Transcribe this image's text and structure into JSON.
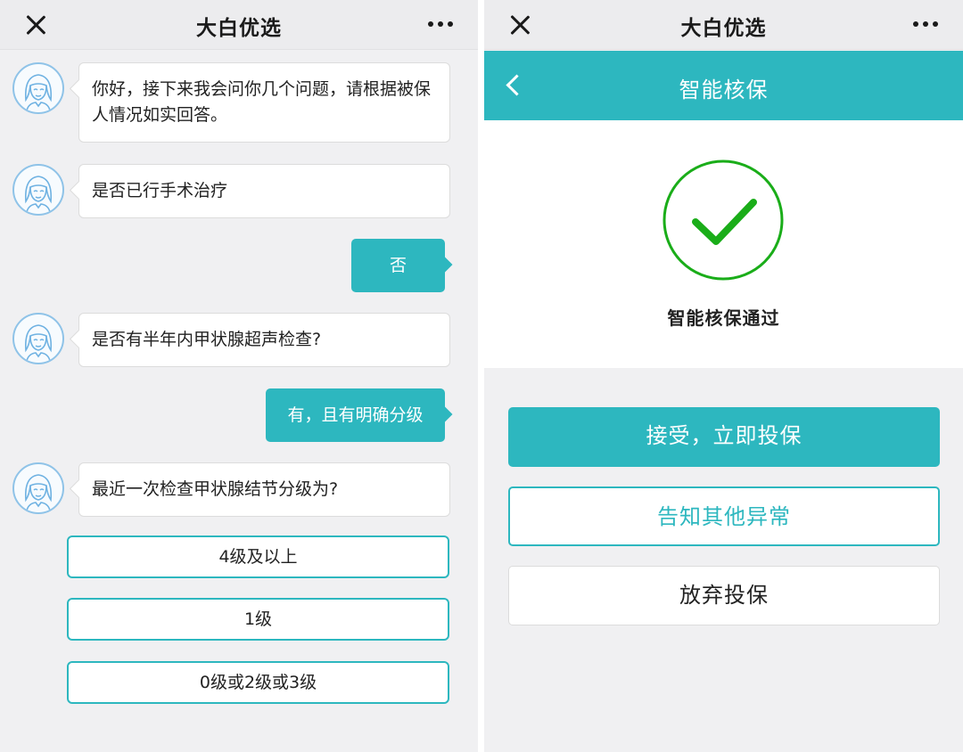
{
  "left": {
    "title": "大白优选",
    "messages": [
      "你好，接下来我会问你几个问题，请根据被保人情况如实回答。",
      "是否已行手术治疗",
      "是否有半年内甲状腺超声检查?",
      "最近一次检查甲状腺结节分级为?"
    ],
    "replies": [
      "否",
      "有，且有明确分级"
    ],
    "options": [
      "4级及以上",
      "1级",
      "0级或2级或3级"
    ]
  },
  "right": {
    "title": "大白优选",
    "header": "智能核保",
    "result": "智能核保通过",
    "buttons": {
      "accept": "接受，立即投保",
      "notify": "告知其他异常",
      "abandon": "放弃投保"
    }
  },
  "colors": {
    "accent": "#2db7bf",
    "success": "#1aad19",
    "avatar_border": "#8fc3e8"
  },
  "icons": [
    "close-icon",
    "more-icon",
    "back-chevron-icon",
    "check-circle-icon",
    "avatar"
  ]
}
